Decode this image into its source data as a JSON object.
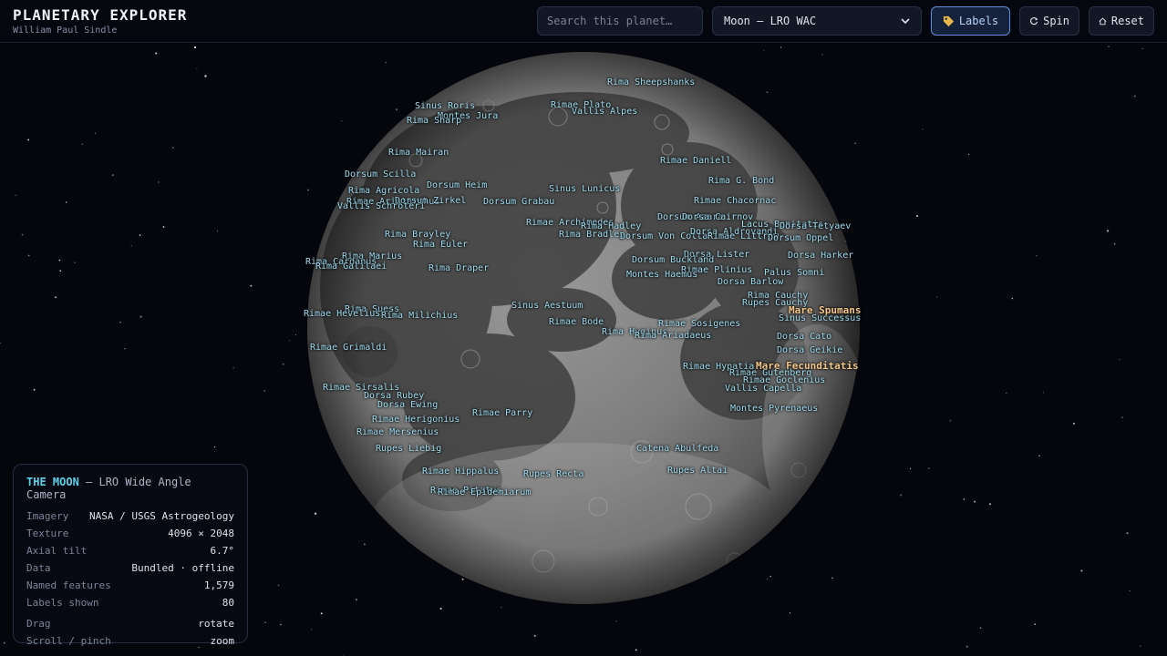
{
  "app": {
    "title": "PLANETARY EXPLORER",
    "author": "William Paul Sindle"
  },
  "search": {
    "placeholder": "Search this planet…"
  },
  "body_select": {
    "selected": "Moon — LRO WAC"
  },
  "toolbar": {
    "labels_btn": "Labels",
    "labels_icon": "tag-icon",
    "labels_active": true,
    "spin_btn": "Spin",
    "spin_icon": "rotate-icon",
    "reset_btn": "Reset",
    "reset_icon": "home-icon"
  },
  "colors": {
    "accent": "#5fd0e8",
    "label": "#9fdcf0",
    "mare_label": "#f4c78a",
    "background": "#05060c"
  },
  "features": [
    {
      "name": "Rima Sheepshanks",
      "type": "feature"
    },
    {
      "name": "Sinus Roris",
      "type": "feature"
    },
    {
      "name": "Rimae Plato",
      "type": "feature"
    },
    {
      "name": "Montes Jura",
      "type": "feature"
    },
    {
      "name": "Vallis Alpes",
      "type": "feature"
    },
    {
      "name": "Rima Sharp",
      "type": "feature"
    },
    {
      "name": "Rima Mairan",
      "type": "feature"
    },
    {
      "name": "Rimae Daniell",
      "type": "feature"
    },
    {
      "name": "Dorsum Scilla",
      "type": "feature"
    },
    {
      "name": "Rima G. Bond",
      "type": "feature"
    },
    {
      "name": "Dorsum Heim",
      "type": "feature"
    },
    {
      "name": "Rima Agricola",
      "type": "feature"
    },
    {
      "name": "Sinus Lunicus",
      "type": "feature"
    },
    {
      "name": "Rimae Aristarchus",
      "type": "feature"
    },
    {
      "name": "Dorsum Zirkel",
      "type": "feature"
    },
    {
      "name": "Dorsum Grabau",
      "type": "feature"
    },
    {
      "name": "Rimae Chacornac",
      "type": "feature"
    },
    {
      "name": "Vallis Schröteri",
      "type": "feature"
    },
    {
      "name": "Dorsum Azara",
      "type": "feature"
    },
    {
      "name": "Dorsa Cairnov",
      "type": "feature"
    },
    {
      "name": "Rimae Archimedes",
      "type": "feature"
    },
    {
      "name": "Rima Hadley",
      "type": "feature"
    },
    {
      "name": "Lacus Bonitatis",
      "type": "feature"
    },
    {
      "name": "Dorsa Tetyaev",
      "type": "feature"
    },
    {
      "name": "Rima Brayley",
      "type": "feature"
    },
    {
      "name": "Rima Bradley",
      "type": "feature"
    },
    {
      "name": "Dorsum Von Cotta",
      "type": "feature"
    },
    {
      "name": "Dorsa Aldrovandi",
      "type": "feature"
    },
    {
      "name": "Rimae Littrow",
      "type": "feature"
    },
    {
      "name": "Dorsum Oppel",
      "type": "feature"
    },
    {
      "name": "Rima Euler",
      "type": "feature"
    },
    {
      "name": "Rima Marius",
      "type": "feature"
    },
    {
      "name": "Dorsa Lister",
      "type": "feature"
    },
    {
      "name": "Dorsa Harker",
      "type": "feature"
    },
    {
      "name": "Rima Cardanus",
      "type": "feature"
    },
    {
      "name": "Dorsum Buckland",
      "type": "feature"
    },
    {
      "name": "Rima Galilaei",
      "type": "feature"
    },
    {
      "name": "Rima Draper",
      "type": "feature"
    },
    {
      "name": "Rimae Plinius",
      "type": "feature"
    },
    {
      "name": "Montes Haemus",
      "type": "feature"
    },
    {
      "name": "Palus Somni",
      "type": "feature"
    },
    {
      "name": "Dorsa Barlow",
      "type": "feature"
    },
    {
      "name": "Rima Cauchy",
      "type": "feature"
    },
    {
      "name": "Sinus Aestuum",
      "type": "feature"
    },
    {
      "name": "Rupes Cauchy",
      "type": "feature"
    },
    {
      "name": "Rima Suess",
      "type": "feature"
    },
    {
      "name": "Mare Spumans",
      "type": "mare"
    },
    {
      "name": "Rimae Hevelius",
      "type": "feature"
    },
    {
      "name": "Rima Milichius",
      "type": "feature"
    },
    {
      "name": "Sinus Successus",
      "type": "feature"
    },
    {
      "name": "Rimae Bode",
      "type": "feature"
    },
    {
      "name": "Rimae Sosigenes",
      "type": "feature"
    },
    {
      "name": "Rima Hyginus",
      "type": "feature"
    },
    {
      "name": "Rima Ariadaeus",
      "type": "feature"
    },
    {
      "name": "Dorsa Cato",
      "type": "feature"
    },
    {
      "name": "Rimae Grimaldi",
      "type": "feature"
    },
    {
      "name": "Dorsa Geikie",
      "type": "feature"
    },
    {
      "name": "Mare Fecunditatis",
      "type": "mare"
    },
    {
      "name": "Rimae Hypatia",
      "type": "feature"
    },
    {
      "name": "Rimae Gutenberg",
      "type": "feature"
    },
    {
      "name": "Rimae Goclenius",
      "type": "feature"
    },
    {
      "name": "Vallis Capella",
      "type": "feature"
    },
    {
      "name": "Rimae Sirsalis",
      "type": "feature"
    },
    {
      "name": "Dorsa Rubey",
      "type": "feature"
    },
    {
      "name": "Dorsa Ewing",
      "type": "feature"
    },
    {
      "name": "Montes Pyrenaeus",
      "type": "feature"
    },
    {
      "name": "Rimae Parry",
      "type": "feature"
    },
    {
      "name": "Rimae Herigonius",
      "type": "feature"
    },
    {
      "name": "Rimae Mersenius",
      "type": "feature"
    },
    {
      "name": "Catena Abulfeda",
      "type": "feature"
    },
    {
      "name": "Rupes Liebig",
      "type": "feature"
    },
    {
      "name": "Rupes Altai",
      "type": "feature"
    },
    {
      "name": "Rimae Hippalus",
      "type": "feature"
    },
    {
      "name": "Rupes Recta",
      "type": "feature"
    },
    {
      "name": "Rimae Pitatus",
      "type": "feature"
    },
    {
      "name": "Rimae Epidemiarum",
      "type": "feature"
    }
  ],
  "info": {
    "title": "THE MOON",
    "subtitle": " — LRO Wide Angle Camera",
    "rows": [
      {
        "key": "Imagery",
        "value": "NASA / USGS Astrogeology"
      },
      {
        "key": "Texture",
        "value": "4096 × 2048"
      },
      {
        "key": "Axial tilt",
        "value": "6.7°"
      },
      {
        "key": "Data",
        "value": "Bundled · offline"
      },
      {
        "key": "Named features",
        "value": "1,579"
      },
      {
        "key": "Labels shown",
        "value": "80"
      }
    ],
    "controls": [
      {
        "key": "Drag",
        "value": "rotate"
      },
      {
        "key": "Scroll / pinch",
        "value": "zoom"
      }
    ]
  }
}
